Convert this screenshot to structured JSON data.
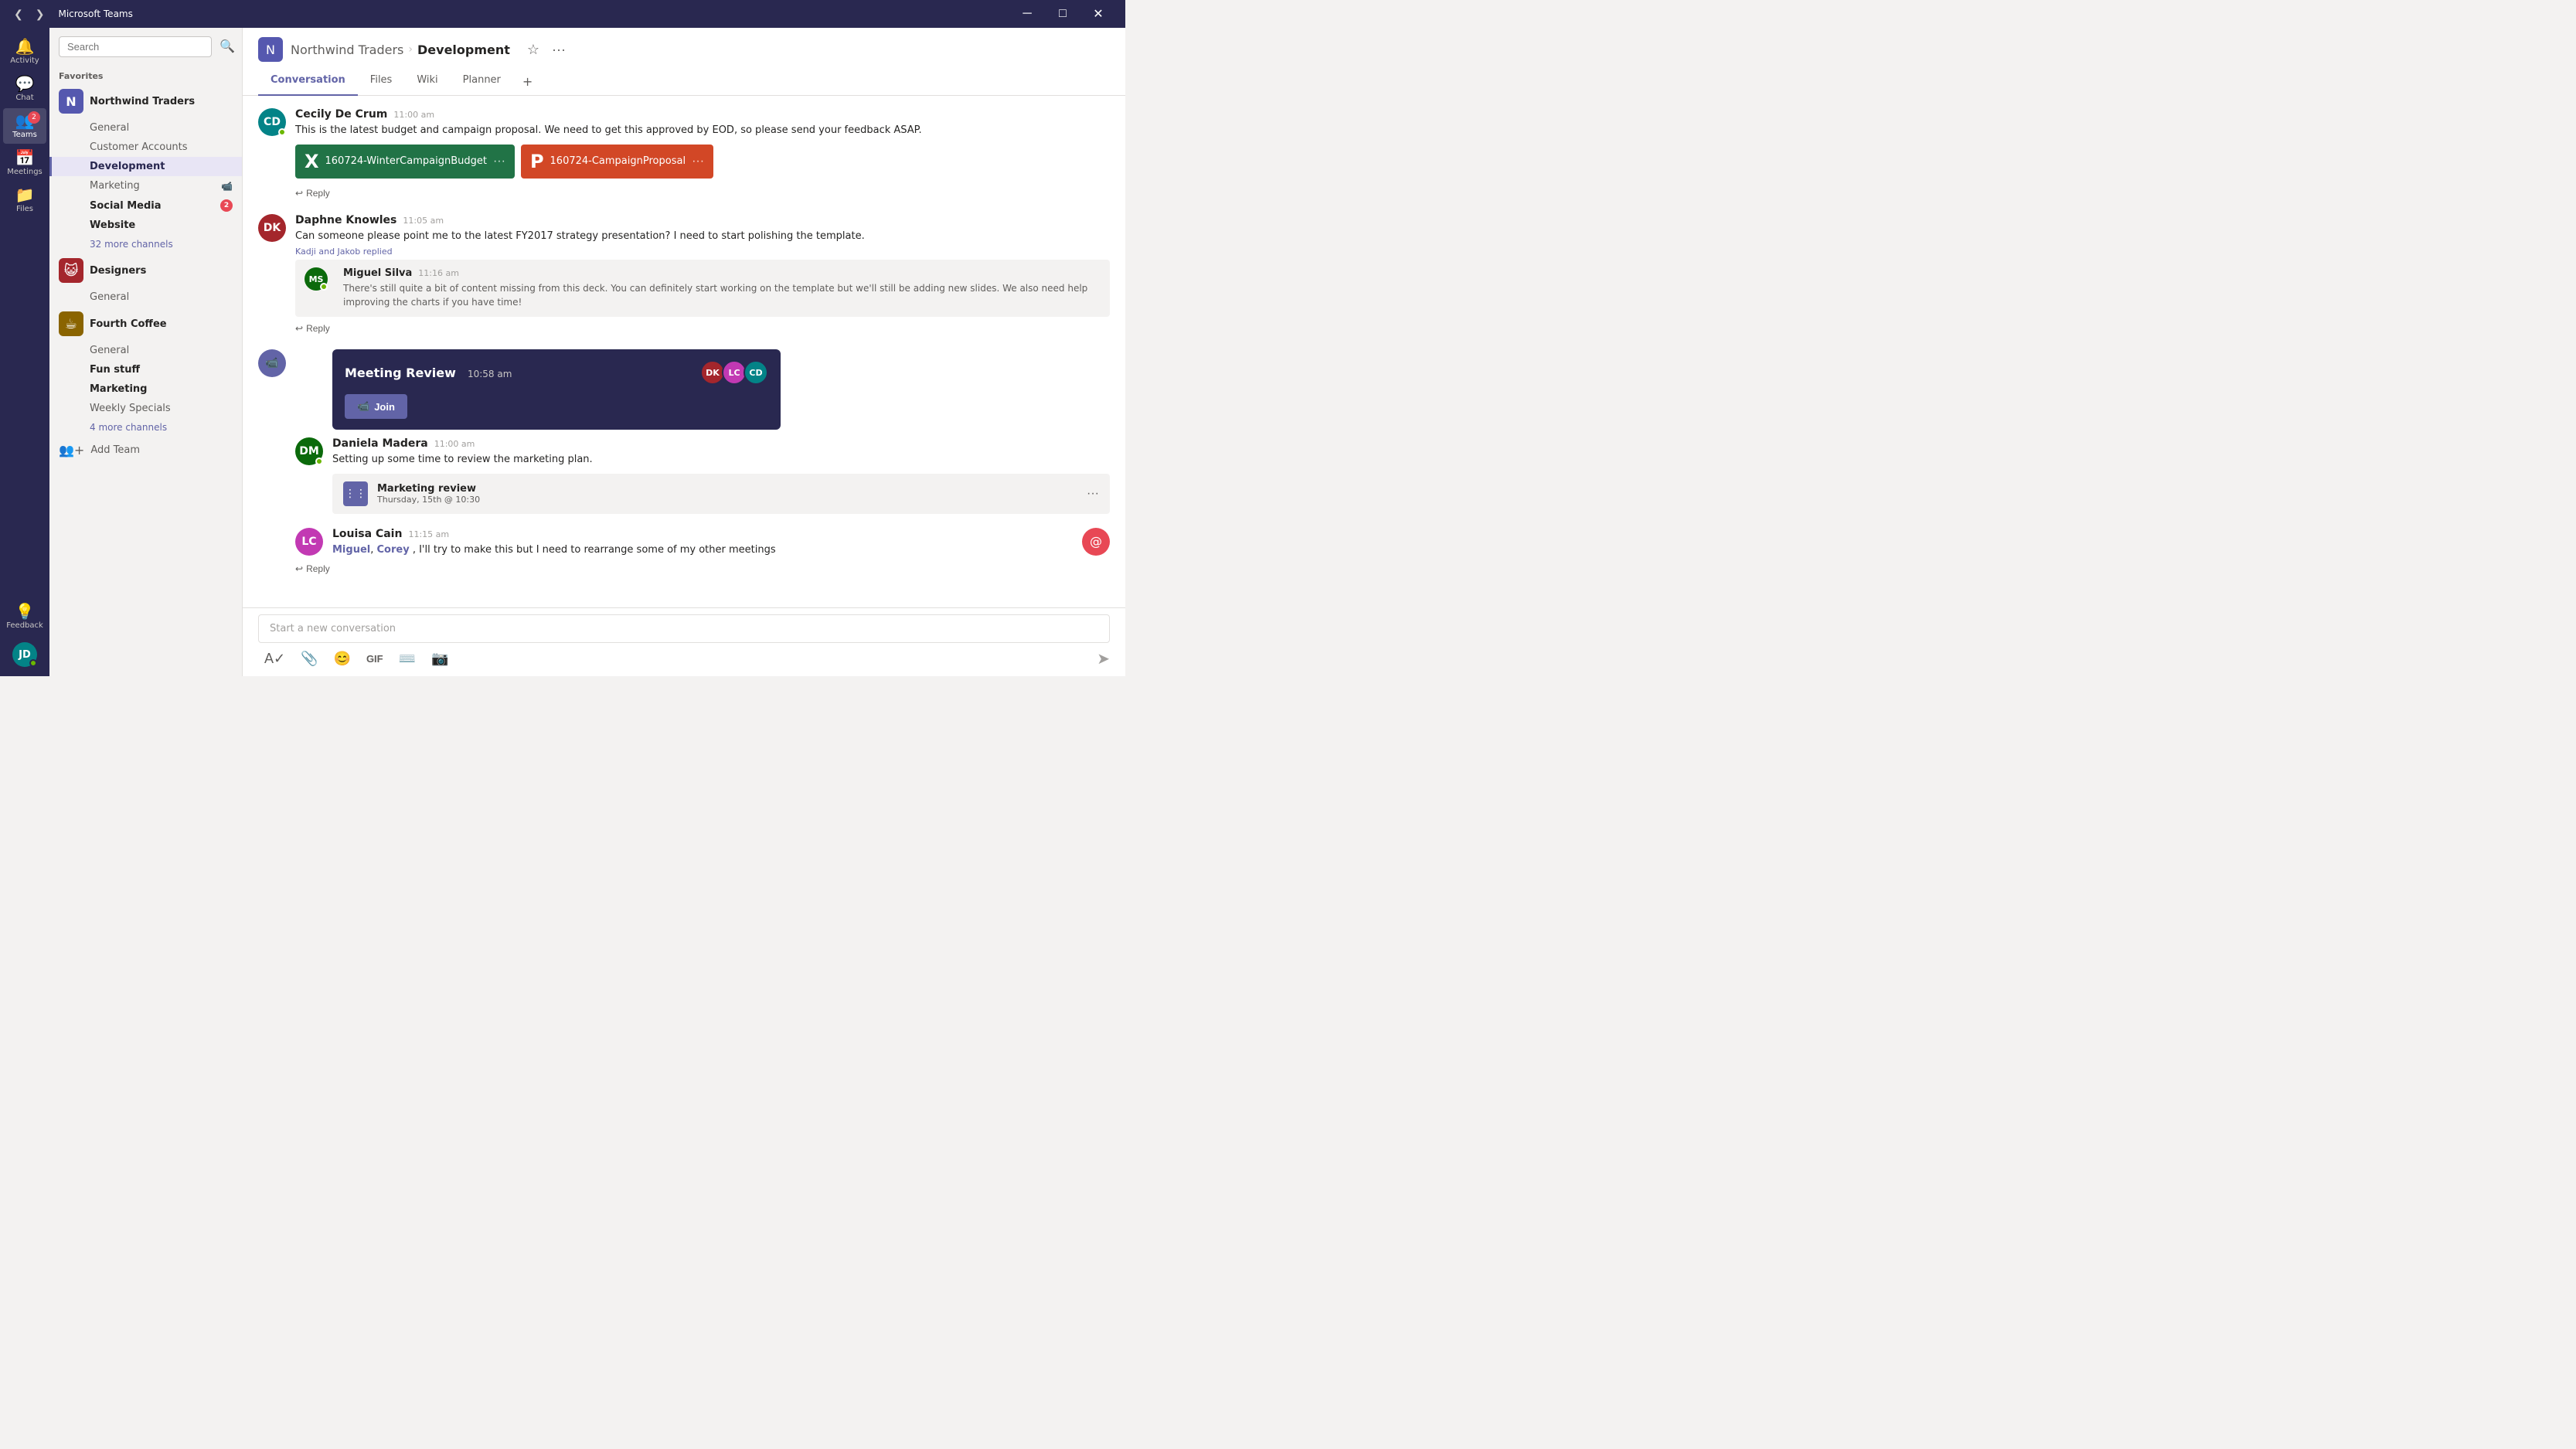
{
  "titlebar": {
    "back_label": "❮",
    "forward_label": "❯",
    "title": "Microsoft Teams",
    "minimize": "─",
    "maximize": "□",
    "close": "✕"
  },
  "icon_nav": {
    "items": [
      {
        "id": "activity",
        "icon": "🔔",
        "label": "Activity"
      },
      {
        "id": "chat",
        "icon": "💬",
        "label": "Chat"
      },
      {
        "id": "teams",
        "icon": "👥",
        "label": "Teams",
        "badge": "2",
        "active": true
      },
      {
        "id": "meetings",
        "icon": "📅",
        "label": "Meetings"
      },
      {
        "id": "files",
        "icon": "📁",
        "label": "Files"
      }
    ],
    "bottom": {
      "feedback": "💡",
      "feedback_label": "Feedback",
      "user_initials": "JD"
    }
  },
  "sidebar": {
    "search_placeholder": "Search",
    "favorites_label": "Favorites",
    "teams": [
      {
        "id": "northwind",
        "name": "Northwind Traders",
        "logo_color": "#5558af",
        "logo_text": "N",
        "channels": [
          {
            "name": "General",
            "active": false,
            "bold": false
          },
          {
            "name": "Customer Accounts",
            "active": false,
            "bold": false
          },
          {
            "name": "Development",
            "active": true,
            "bold": false
          },
          {
            "name": "Marketing",
            "active": false,
            "bold": false,
            "icon": "📹"
          },
          {
            "name": "Social Media",
            "active": false,
            "bold": true,
            "badge": "2"
          },
          {
            "name": "Website",
            "active": false,
            "bold": true
          }
        ],
        "more_channels": "32 more channels"
      },
      {
        "id": "designers",
        "name": "Designers",
        "logo_color": "#a4262c",
        "logo_text": "😺",
        "channels": [
          {
            "name": "General",
            "active": false,
            "bold": false
          }
        ]
      },
      {
        "id": "fourthcoffee",
        "name": "Fourth Coffee",
        "logo_color": "#8a6400",
        "logo_text": "☕",
        "channels": [
          {
            "name": "General",
            "active": false,
            "bold": false
          },
          {
            "name": "Fun stuff",
            "active": false,
            "bold": true
          },
          {
            "name": "Marketing",
            "active": false,
            "bold": true
          },
          {
            "name": "Weekly Specials",
            "active": false,
            "bold": false
          }
        ],
        "more_channels": "4 more channels"
      }
    ],
    "add_team_label": "Add Team"
  },
  "channel_header": {
    "team_name": "Northwind Traders",
    "channel_name": "Development",
    "logo_color": "#5558af",
    "logo_text": "N",
    "tabs": [
      {
        "id": "conversation",
        "label": "Conversation",
        "active": true
      },
      {
        "id": "files",
        "label": "Files",
        "active": false
      },
      {
        "id": "wiki",
        "label": "Wiki",
        "active": false
      },
      {
        "id": "planner",
        "label": "Planner",
        "active": false
      }
    ]
  },
  "messages": [
    {
      "id": "msg1",
      "author": "Cecily De Crum",
      "time": "11:00 am",
      "avatar_initials": "CD",
      "avatar_color": "#038387",
      "online": true,
      "text": "This is the latest budget and campaign proposal. We need to get this approved by EOD, so please send your feedback ASAP.",
      "attachments": [
        {
          "type": "excel",
          "name": "160724-WinterCampaignBudget"
        },
        {
          "type": "powerpoint",
          "name": "160724-CampaignProposal"
        }
      ],
      "reply_label": "Reply"
    },
    {
      "id": "msg2",
      "author": "Daphne Knowles",
      "time": "11:05 am",
      "avatar_initials": "DK",
      "avatar_color": "#a4262c",
      "online": false,
      "text": "Can someone please point me to the latest FY2017 strategy presentation? I need to start polishing the template.",
      "replied_by": "Kadji and Jakob replied",
      "nested_reply": {
        "author": "Miguel Silva",
        "time": "11:16 am",
        "avatar_initials": "MS",
        "avatar_color": "#0b6a0b",
        "online": true,
        "text": "There's still quite a bit of content missing from this deck. You can definitely start working on the template but we'll still be adding new slides. We also need help improving the charts if you have time!"
      },
      "reply_label": "Reply"
    },
    {
      "id": "msg3_meeting",
      "type": "meeting",
      "avatar_icon": "📹",
      "title": "Meeting Review",
      "time": "10:58 am",
      "participants": [
        "LC",
        "DK"
      ],
      "join_label": "Join",
      "sub_message": {
        "author": "Daniela Madera",
        "time": "11:00 am",
        "avatar_initials": "DM",
        "avatar_color": "#0b6a0b",
        "online": true,
        "text": "Setting up some time to review the marketing plan."
      },
      "calendar_event": {
        "title": "Marketing review",
        "time": "Thursday, 15th @ 10:30"
      },
      "reply_message": {
        "author": "Louisa Cain",
        "time": "11:15 am",
        "avatar_initials": "LC",
        "avatar_color": "#c239b3",
        "mentions": [
          "Miguel",
          "Corey"
        ],
        "text": ", I'll try to make this but I need to rearrange some of my other meetings"
      },
      "reply_label": "Reply"
    }
  ],
  "compose": {
    "placeholder": "Start a new conversation",
    "toolbar_icons": [
      "✏️",
      "📎",
      "😊",
      "GIF",
      "⌨️",
      "📷"
    ]
  }
}
